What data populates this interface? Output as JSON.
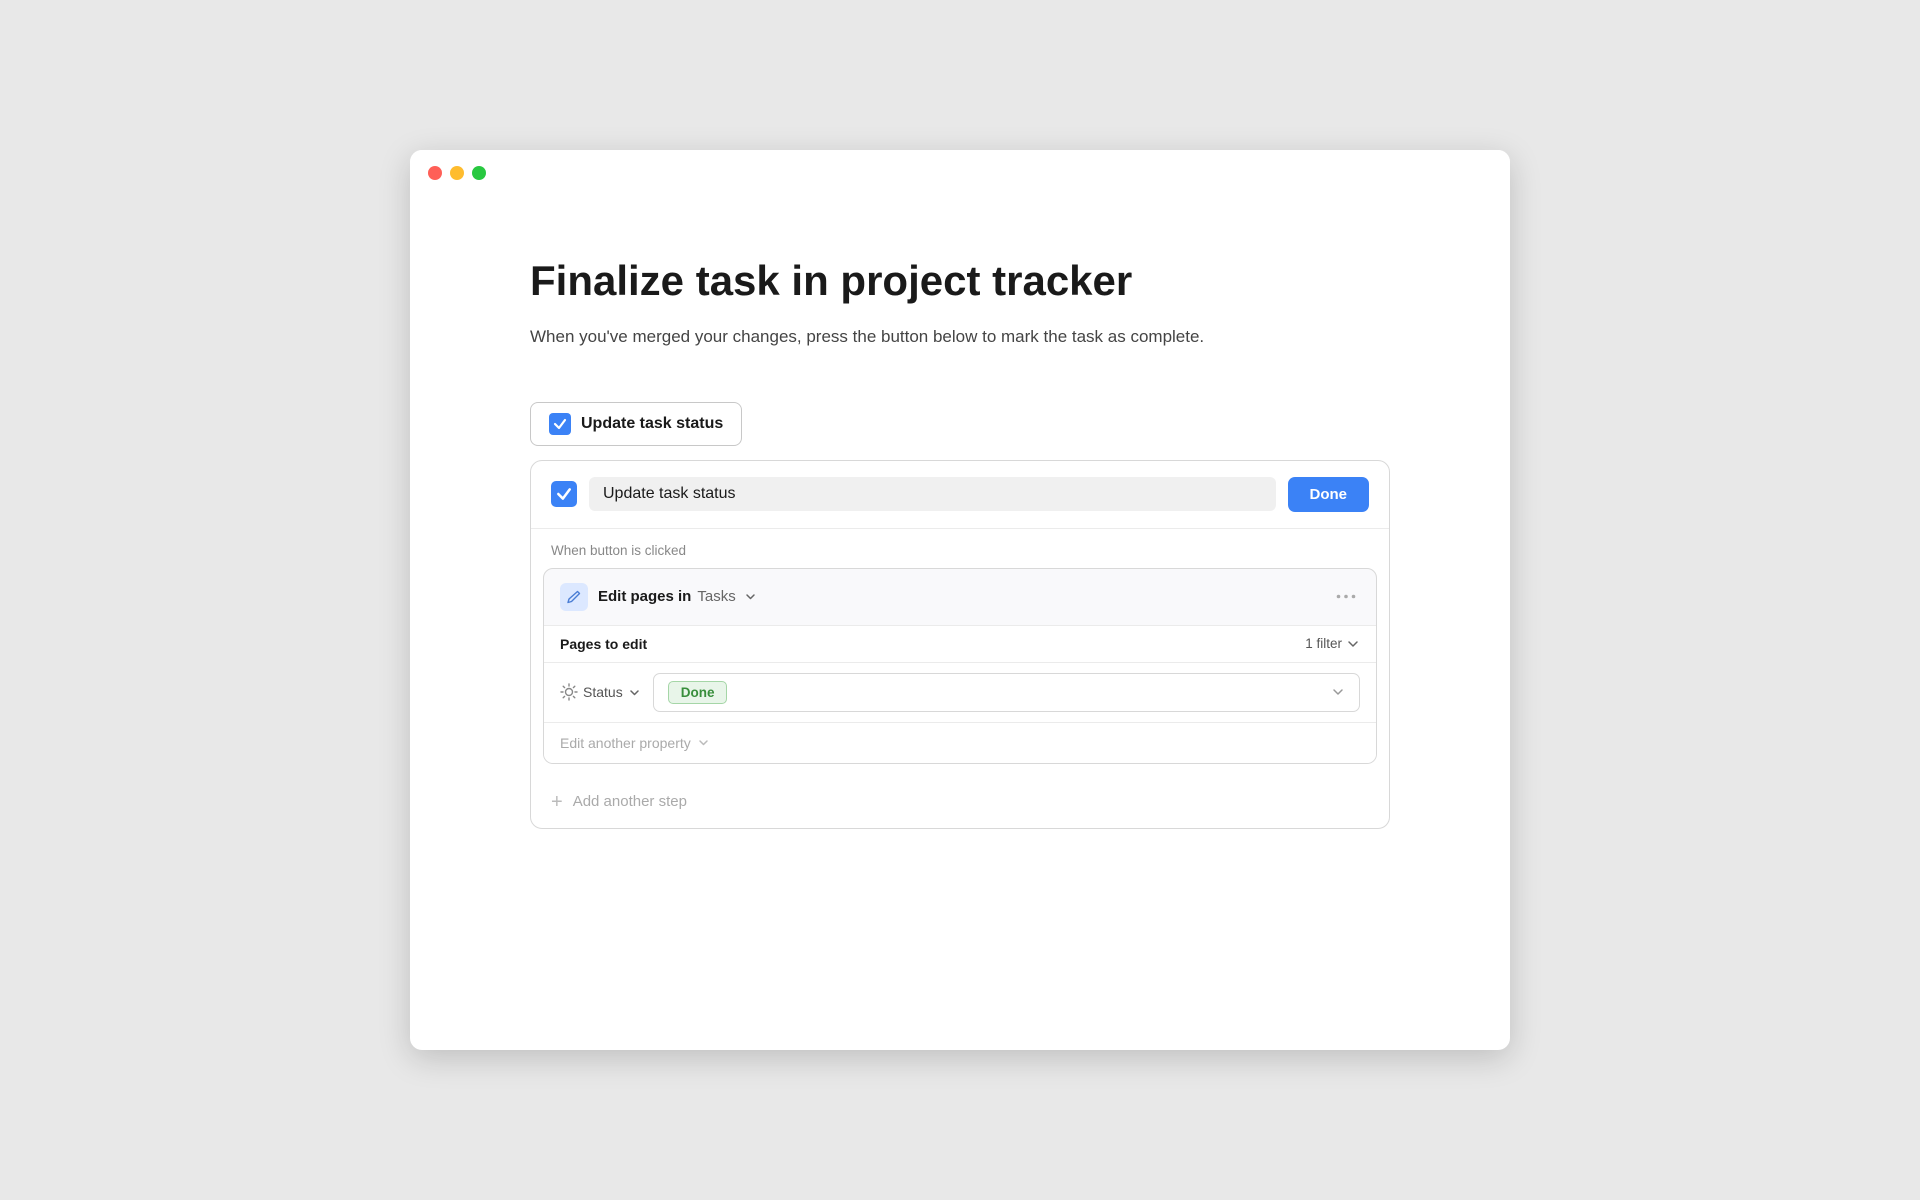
{
  "window": {
    "dots": [
      "red",
      "yellow",
      "green"
    ]
  },
  "page": {
    "title": "Finalize task in project tracker",
    "subtitle": "When you've merged your changes, press the button below to mark the task as complete."
  },
  "action_button": {
    "label": "Update task status"
  },
  "card": {
    "title_input_value": "Update task status",
    "done_button_label": "Done",
    "when_label": "When button is clicked",
    "action_block": {
      "prefix": "Edit pages in",
      "db_name": "Tasks",
      "pages_to_edit_label": "Pages to edit",
      "filter_label": "1 filter",
      "property_label": "Status",
      "property_value": "Done",
      "edit_another_label": "Edit another property"
    },
    "add_step_label": "Add another step"
  }
}
